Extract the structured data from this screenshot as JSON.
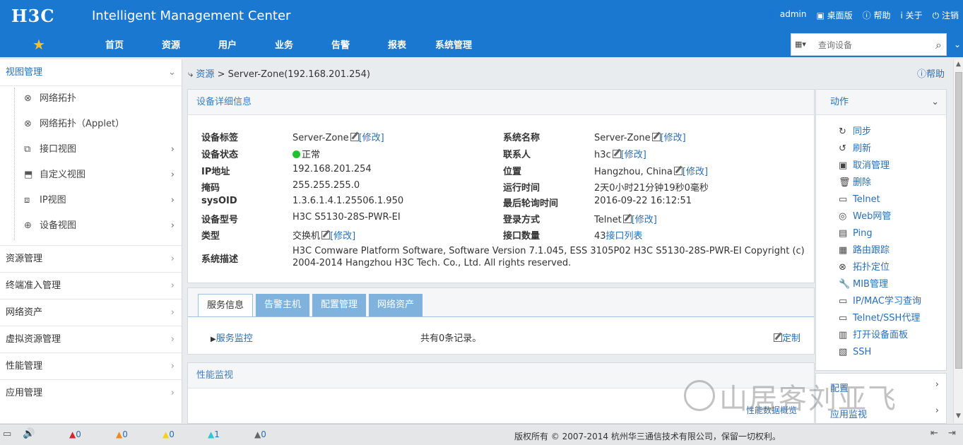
{
  "header": {
    "logo": "H3C",
    "app_title": "Intelligent Management Center",
    "links": [
      "admin",
      "桌面版",
      "帮助",
      "关于",
      "注销"
    ],
    "nav": [
      "首页",
      "资源",
      "用户",
      "业务",
      "告警",
      "报表",
      "系统管理"
    ],
    "search_placeholder": "查询设备"
  },
  "sidebar": {
    "head": "视图管理",
    "items": [
      {
        "label": "网络拓扑",
        "icon": "topology-icon"
      },
      {
        "label": "网络拓扑（Applet）",
        "icon": "topology-icon"
      },
      {
        "label": "接口视图",
        "icon": "interface-icon"
      },
      {
        "label": "自定义视图",
        "icon": "custom-view-icon"
      },
      {
        "label": "IP视图",
        "icon": "ip-view-icon"
      },
      {
        "label": "设备视图",
        "icon": "device-view-icon"
      }
    ],
    "groups": [
      "资源管理",
      "终端准入管理",
      "网络资产",
      "虚拟资源管理",
      "性能管理",
      "应用管理"
    ]
  },
  "breadcrumb": {
    "root": "资源",
    "sep": ">",
    "current": "Server-Zone(192.168.201.254)"
  },
  "help": "帮助",
  "detail": {
    "title": "设备详细信息",
    "edit": "[修改]",
    "left": [
      {
        "k": "设备标签",
        "v": "Server-Zone",
        "edit": true
      },
      {
        "k": "设备状态",
        "v": "正常",
        "status": true
      },
      {
        "k": "IP地址",
        "v": "192.168.201.254"
      },
      {
        "k": "掩码",
        "v": "255.255.255.0"
      },
      {
        "k": "sysOID",
        "v": "1.3.6.1.4.1.25506.1.950"
      },
      {
        "k": "设备型号",
        "v": "H3C S5130-28S-PWR-EI"
      },
      {
        "k": "类型",
        "v": "交换机",
        "edit": true
      }
    ],
    "right": [
      {
        "k": "系统名称",
        "v": "Server-Zone",
        "edit": true
      },
      {
        "k": "联系人",
        "v": "h3c",
        "edit": true
      },
      {
        "k": "位置",
        "v": "Hangzhou, China",
        "edit": true
      },
      {
        "k": "运行时间",
        "v": "2天0小时21分钟19秒0毫秒"
      },
      {
        "k": "最后轮询时间",
        "v": "2016-09-22 16:12:51"
      },
      {
        "k": "登录方式",
        "v": "Telnet",
        "edit": true
      },
      {
        "k": "接口数量",
        "v": "43",
        "link": "接口列表"
      }
    ],
    "sysdesc_label": "系统描述",
    "sysdesc_1": "H3C Comware Platform Software, Software Version 7.1.045, ESS 3105P02 H3C S5130-28S-PWR-EI Copyright (c)",
    "sysdesc_2": "2004-2014 Hangzhou H3C Tech. Co., Ltd. All rights reserved."
  },
  "tabs": [
    "服务信息",
    "告警主机",
    "配置管理",
    "网络资产"
  ],
  "service": {
    "link": "服务监控",
    "count": "共有0条记录。",
    "customize": "定制"
  },
  "perf": {
    "title": "性能监视",
    "overview": "性能数据概览"
  },
  "actions": {
    "head": "动作",
    "items": [
      {
        "label": "同步",
        "icon": "sync-icon",
        "glyph": "↻"
      },
      {
        "label": "刷新",
        "icon": "refresh-icon",
        "glyph": "↺"
      },
      {
        "label": "取消管理",
        "icon": "unmanage-icon",
        "glyph": "▣"
      },
      {
        "label": "删除",
        "icon": "trash-icon",
        "glyph": "🗑"
      },
      {
        "label": "Telnet",
        "icon": "telnet-icon",
        "glyph": "▭"
      },
      {
        "label": "Web网管",
        "icon": "web-icon",
        "glyph": "◎"
      },
      {
        "label": "Ping",
        "icon": "ping-icon",
        "glyph": "▤"
      },
      {
        "label": "路由跟踪",
        "icon": "traceroute-icon",
        "glyph": "▦"
      },
      {
        "label": "拓扑定位",
        "icon": "topology-locate-icon",
        "glyph": "⊗"
      },
      {
        "label": "MIB管理",
        "icon": "wrench-icon",
        "glyph": "🔧"
      },
      {
        "label": "IP/MAC学习查询",
        "icon": "ipmac-icon",
        "glyph": "▭"
      },
      {
        "label": "Telnet/SSH代理",
        "icon": "proxy-icon",
        "glyph": "▭"
      },
      {
        "label": "打开设备面板",
        "icon": "panel-icon",
        "glyph": "▥"
      },
      {
        "label": "SSH",
        "icon": "ssh-icon",
        "glyph": "▧"
      }
    ],
    "config": "配置",
    "app_monitor": "应用监视"
  },
  "status": {
    "alarms": [
      {
        "count": "0",
        "color": "#d9232d"
      },
      {
        "count": "0",
        "color": "#f08a1d"
      },
      {
        "count": "0",
        "color": "#f2d21a"
      },
      {
        "count": "1",
        "color": "#2ec7d4"
      },
      {
        "count": "0",
        "color": "#666666"
      }
    ],
    "copyright": "版权所有 © 2007-2014 杭州华三通信技术有限公司，保留一切权利。"
  },
  "watermark": "山居客刘亚飞"
}
